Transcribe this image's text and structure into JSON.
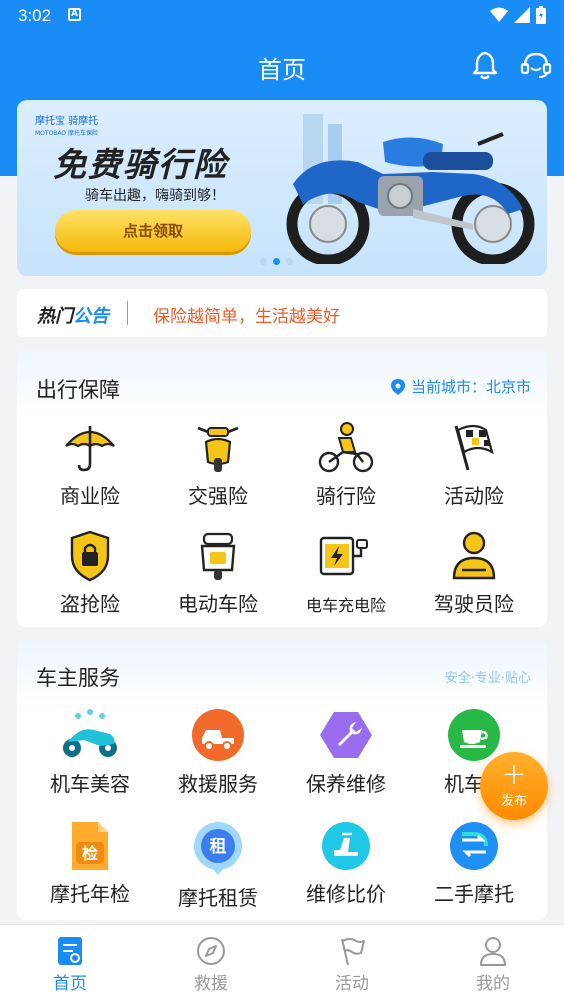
{
  "status_bar": {
    "time": "3:02",
    "notification_icon": "A"
  },
  "header": {
    "title": "首页",
    "bell_icon": "bell-icon",
    "support_icon": "headset-icon"
  },
  "banner": {
    "logo_text": "摩托宝 骑摩托",
    "logo_sub": "MOTOBAO 摩托车保险",
    "headline": "免费骑行险",
    "subline": "骑车出趣，嗨骑到够！",
    "button_label": "点击领取",
    "page_count": 3,
    "active_page": 2
  },
  "notice": {
    "tag_part1": "热门",
    "tag_part2": "公告",
    "text": "保险越简单，生活越美好"
  },
  "travel_section": {
    "title": "出行保障",
    "city_label": "当前城市：北京市",
    "items": [
      {
        "label": "商业险",
        "icon": "umbrella-icon"
      },
      {
        "label": "交强险",
        "icon": "scooter-icon"
      },
      {
        "label": "骑行险",
        "icon": "rider-icon"
      },
      {
        "label": "活动险",
        "icon": "flag-icon"
      },
      {
        "label": "盗抢险",
        "icon": "lock-shield-icon"
      },
      {
        "label": "电动车险",
        "icon": "ebike-icon"
      },
      {
        "label": "电车充电险",
        "icon": "charging-icon"
      },
      {
        "label": "驾驶员险",
        "icon": "driver-icon"
      }
    ]
  },
  "owner_section": {
    "title": "车主服务",
    "slogan": "安全·专业·贴心",
    "items": [
      {
        "label": "机车美容",
        "icon": "motorbike-wash-icon"
      },
      {
        "label": "救援服务",
        "icon": "tow-truck-icon"
      },
      {
        "label": "保养维修",
        "icon": "wrench-icon"
      },
      {
        "label": "机车咖",
        "icon": "coffee-icon"
      },
      {
        "label": "摩托年检",
        "icon": "inspection-icon",
        "badge": "检"
      },
      {
        "label": "摩托租赁",
        "icon": "rental-icon",
        "badge": "租"
      },
      {
        "label": "维修比价",
        "icon": "compare-icon"
      },
      {
        "label": "二手摩托",
        "icon": "exchange-icon"
      }
    ]
  },
  "fab": {
    "plus": "+",
    "label": "发布"
  },
  "tabbar": {
    "tabs": [
      {
        "label": "首页",
        "icon": "home-icon",
        "active": true
      },
      {
        "label": "救援",
        "icon": "compass-icon",
        "active": false
      },
      {
        "label": "活动",
        "icon": "flag-outline-icon",
        "active": false
      },
      {
        "label": "我的",
        "icon": "profile-icon",
        "active": false
      }
    ]
  },
  "colors": {
    "primary": "#1a8cf5",
    "accent_yellow": "#f5c518",
    "notice_red": "#f05a28",
    "fab_orange": "#ff9a1a"
  }
}
